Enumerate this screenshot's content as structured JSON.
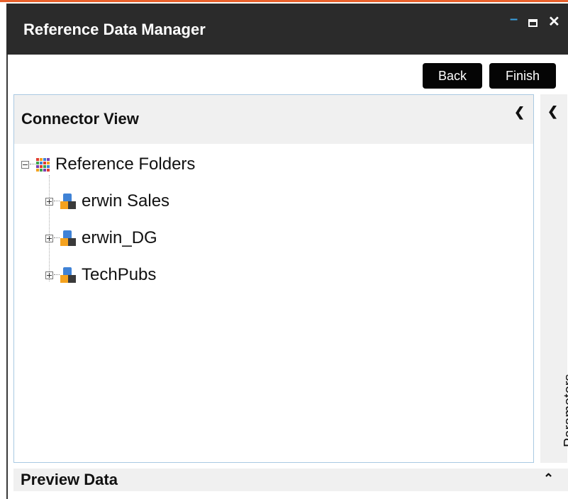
{
  "window": {
    "title": "Reference Data Manager",
    "accent_color": "#e8612c",
    "controls": {
      "minimize": "–",
      "close": "✕"
    }
  },
  "toolbar": {
    "back_label": "Back",
    "finish_label": "Finish"
  },
  "connector_view": {
    "title": "Connector View",
    "collapse_icon": "chevron-left",
    "tree": {
      "root": {
        "label": "Reference Folders",
        "expanded": true
      },
      "children": [
        {
          "label": "erwin Sales",
          "expanded": false
        },
        {
          "label": "erwin_DG",
          "expanded": false
        },
        {
          "label": "TechPubs",
          "expanded": false
        }
      ]
    }
  },
  "parameters_panel": {
    "label": "Parameters",
    "collapse_icon": "chevron-left"
  },
  "preview": {
    "title": "Preview Data",
    "toggle_icon": "chevron-up"
  }
}
